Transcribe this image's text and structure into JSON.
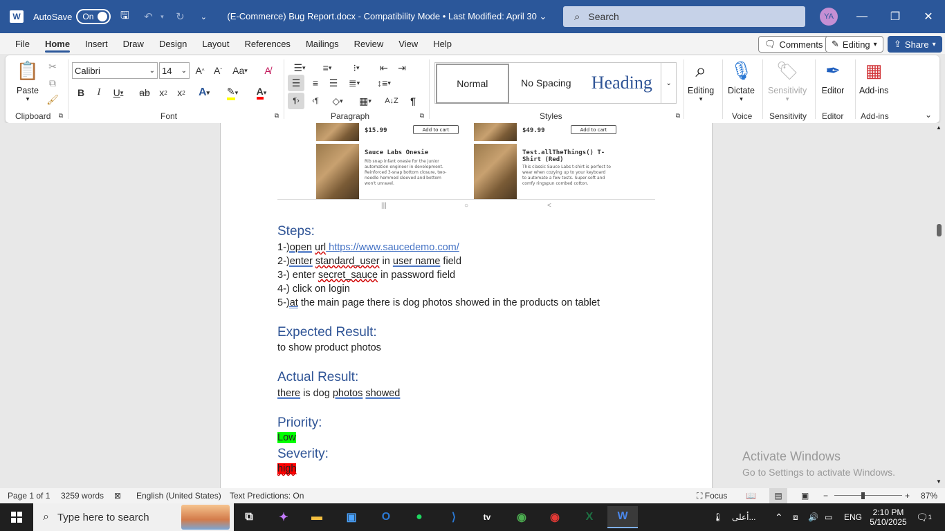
{
  "titlebar": {
    "autosave_label": "AutoSave",
    "autosave_state": "On",
    "document_title": "(E-Commerce) Bug Report.docx  -  Compatibility Mode  •  Last Modified: April 30",
    "search_placeholder": "Search",
    "avatar_initials": "YA"
  },
  "menu": {
    "tabs": [
      "File",
      "Home",
      "Insert",
      "Draw",
      "Design",
      "Layout",
      "References",
      "Mailings",
      "Review",
      "View",
      "Help"
    ],
    "active_tab": "Home",
    "comments_label": "Comments",
    "editing_label": "Editing",
    "share_label": "Share"
  },
  "ribbon": {
    "paste_label": "Paste",
    "font_name": "Calibri",
    "font_size": "14",
    "groups": {
      "clipboard": "Clipboard",
      "font": "Font",
      "paragraph": "Paragraph",
      "styles": "Styles",
      "voice": "Voice",
      "sensitivity": "Sensitivity",
      "editor": "Editor",
      "addins": "Add-ins"
    },
    "styles": [
      "Normal",
      "No Spacing",
      "Heading"
    ],
    "buttons": {
      "editing": "Editing",
      "dictate": "Dictate",
      "sensitivity": "Sensitivity",
      "editor": "Editor",
      "addins": "Add-ins"
    }
  },
  "screenshot": {
    "products": [
      {
        "name": "",
        "price": "$15.99",
        "cart": "Add to cart"
      },
      {
        "name": "",
        "price": "$49.99",
        "cart": "Add to cart"
      },
      {
        "name": "Sauce Labs Onesie",
        "desc": "Rib snap infant onesie for the junior automation engineer in development. Reinforced 3-snap bottom closure, two-needle hemmed sleeved and bottom won't unravel."
      },
      {
        "name": "Test.allTheThings() T-Shirt (Red)",
        "desc": "This classic Sauce Labs t-shirt is perfect to wear when cozying up to your keyboard to automate a few tests. Super-soft and comfy ringspun combed cotton."
      }
    ],
    "nav": [
      "|||",
      "○",
      "<"
    ]
  },
  "document": {
    "steps_heading": "Steps:",
    "step1_a": "1-",
    "step1_b": ")open",
    "step1_c": "url",
    "step1_link": " https://www.saucedemo.com/",
    "step2_a": "2-",
    "step2_b": ")enter",
    "step2_c": "standard_user",
    "step2_d": " in ",
    "step2_e": "user name",
    "step2_f": " field",
    "step3_a": "3-) enter ",
    "step3_b": "secret_sauce",
    "step3_c": " in password field",
    "step4": "4-) click on login",
    "step5_a": "5-",
    "step5_b": ")at",
    "step5_c": " the main page there is dog photos showed in the products on tablet",
    "expected_heading": "Expected Result:",
    "expected_text": "to show product photos",
    "actual_heading": "Actual Result:",
    "actual_a": "there",
    "actual_b": " is dog ",
    "actual_c": "photos",
    "actual_d": " ",
    "actual_e": "showed",
    "priority_heading": "Priority:",
    "priority_value": "Low",
    "severity_heading": "Severity:",
    "severity_value": "high"
  },
  "watermark": {
    "line1": "Activate Windows",
    "line2": "Go to Settings to activate Windows."
  },
  "status": {
    "page": "Page 1 of 1",
    "words": "3259 words",
    "language": "English (United States)",
    "text_predictions": "Text Predictions: On",
    "focus": "Focus",
    "zoom": "87%"
  },
  "taskbar": {
    "search_placeholder": "Type here to search",
    "tray_text": "أعلى...",
    "lang": "ENG",
    "time": "2:10 PM",
    "date": "5/10/2025",
    "notifications": "1"
  },
  "colors": {
    "word_blue": "#2b579a",
    "heading_blue": "#2f5496",
    "highlight_green": "#00ff00",
    "highlight_red": "#ff0000"
  }
}
